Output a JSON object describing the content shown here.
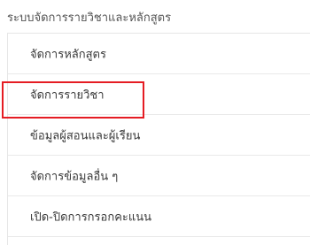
{
  "section": {
    "title": "ระบบจัดการรายวิชาและหลักสูตร"
  },
  "menu": {
    "items": [
      {
        "label": "จัดการหลักสูตร"
      },
      {
        "label": "จัดการรายวิชา"
      },
      {
        "label": "ข้อมูลผู้สอนและผู้เรียน"
      },
      {
        "label": "จัดการข้อมูลอื่น ๆ"
      },
      {
        "label": "เปิด-ปิดการกรอกคะแนน"
      }
    ]
  },
  "colors": {
    "highlight": "#e51c23",
    "divider": "#e9e9e9",
    "text": "#3a3a3a"
  }
}
